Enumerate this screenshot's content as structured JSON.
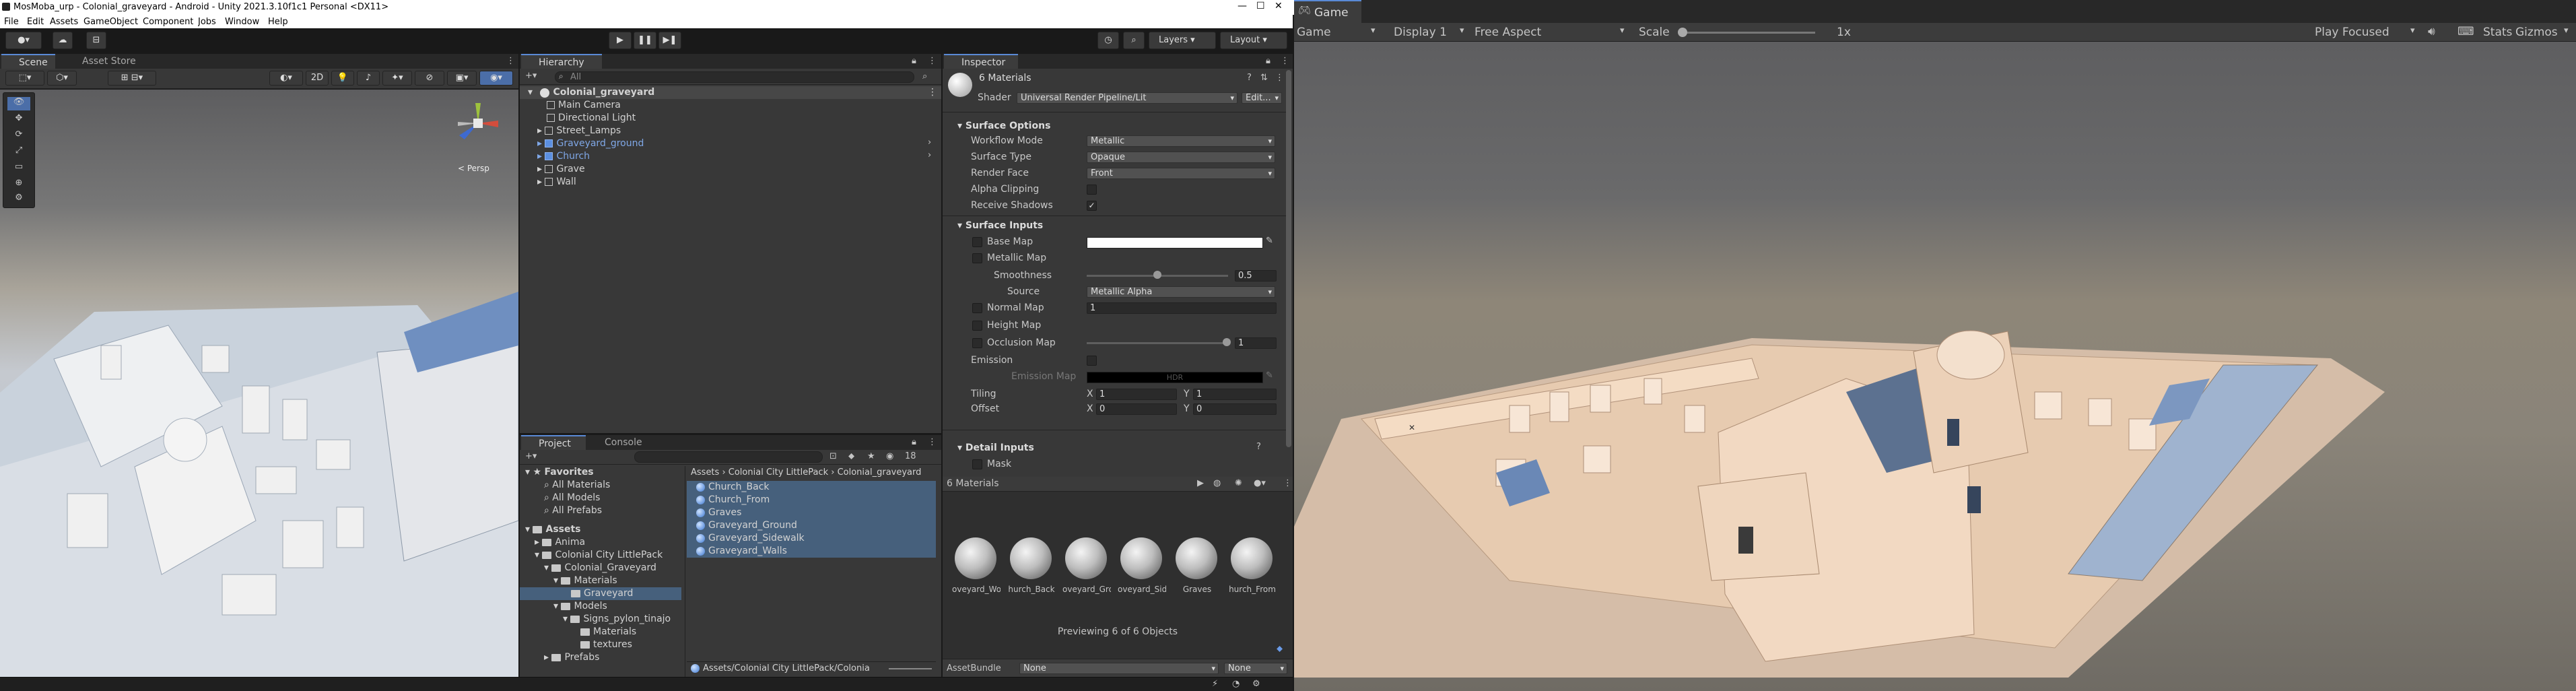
{
  "window": {
    "title": "MosMoba_urp - Colonial_graveyard - Android - Unity 2021.3.10f1c1 Personal <DX11>"
  },
  "menu": [
    "File",
    "Edit",
    "Assets",
    "GameObject",
    "Component",
    "Jobs",
    "Window",
    "Help"
  ],
  "toolbar": {
    "layers_label": "Layers",
    "layout_label": "Layout"
  },
  "scene": {
    "tab_scene": "Scene",
    "tab_asset_store": "Asset Store",
    "mode_2d": "2D",
    "persp_label": "< Persp"
  },
  "hierarchy": {
    "tab": "Hierarchy",
    "search_placeholder": "All",
    "scene_name": "Colonial_graveyard",
    "items": [
      {
        "name": "Main Camera"
      },
      {
        "name": "Directional Light"
      },
      {
        "name": "Street_Lamps"
      },
      {
        "name": "Graveyard_ground"
      },
      {
        "name": "Church"
      },
      {
        "name": "Grave"
      },
      {
        "name": "Wall"
      }
    ]
  },
  "project": {
    "tab_project": "Project",
    "tab_console": "Console",
    "count_badge": "18",
    "tree": [
      "Favorites",
      "All Materials",
      "All Models",
      "All Prefabs",
      "Assets",
      "Anima",
      "Colonial City LittlePack",
      "Colonial_Graveyard",
      "Materials",
      "Graveyard",
      "Models",
      "Signs_pylon_tinajo",
      "Materials",
      "textures",
      "Prefabs"
    ],
    "breadcrumb": [
      "Assets",
      "Colonial City LittlePack",
      "Colonial_graveyard"
    ],
    "files": [
      "Church_Back",
      "Church_From",
      "Graves",
      "Graveyard_Ground",
      "Graveyard_Sidewalk",
      "Graveyard_Walls"
    ],
    "footer_path": "Assets/Colonial City LittlePack/Colonia"
  },
  "inspector": {
    "tab": "Inspector",
    "object_title": "6 Materials",
    "shader_label": "Shader",
    "shader_value": "Universal Render Pipeline/Lit",
    "edit_button": "Edit...",
    "surface_options_header": "Surface Options",
    "workflow_mode_label": "Workflow Mode",
    "workflow_mode_value": "Metallic",
    "surface_type_label": "Surface Type",
    "surface_type_value": "Opaque",
    "render_face_label": "Render Face",
    "render_face_value": "Front",
    "alpha_clipping_label": "Alpha Clipping",
    "receive_shadows_label": "Receive Shadows",
    "surface_inputs_header": "Surface Inputs",
    "base_map_label": "Base Map",
    "metallic_map_label": "Metallic Map",
    "smoothness_label": "Smoothness",
    "smoothness_value": "0.5",
    "smoothness_fraction": 0.5,
    "source_label": "Source",
    "source_value": "Metallic Alpha",
    "normal_map_label": "Normal Map",
    "normal_map_value": "1",
    "height_map_label": "Height Map",
    "occlusion_map_label": "Occlusion Map",
    "occlusion_value": "1",
    "occlusion_fraction": 1.0,
    "emission_label": "Emission",
    "emission_map_label": "Emission Map",
    "hdr_label": "HDR",
    "tiling_label": "Tiling",
    "tiling_x": "1",
    "tiling_y": "1",
    "offset_label": "Offset",
    "offset_x": "0",
    "offset_y": "0",
    "x_label": "X",
    "y_label": "Y",
    "detail_inputs_header": "Detail Inputs",
    "mask_label": "Mask",
    "preview_title": "6 Materials",
    "preview_items": [
      "oveyard_Wo",
      "hurch_Back",
      "oveyard_Grou",
      "oveyard_Sidev",
      "Graves",
      "hurch_From"
    ],
    "previewing_text": "Previewing 6 of 6 Objects",
    "assetbundle_label": "AssetBundle",
    "assetbundle_value": "None",
    "assetbundle_variant": "None"
  },
  "game": {
    "tab": "Game",
    "view_mode": "Game",
    "display": "Display 1",
    "aspect": "Free Aspect",
    "scale_label": "Scale",
    "scale_value": "1x",
    "play_focused": "Play Focused",
    "stats": "Stats",
    "gizmos": "Gizmos"
  },
  "colors": {
    "accent": "#5a8ad6",
    "selection": "#46607c",
    "panel": "#383838",
    "background": "#191919"
  }
}
